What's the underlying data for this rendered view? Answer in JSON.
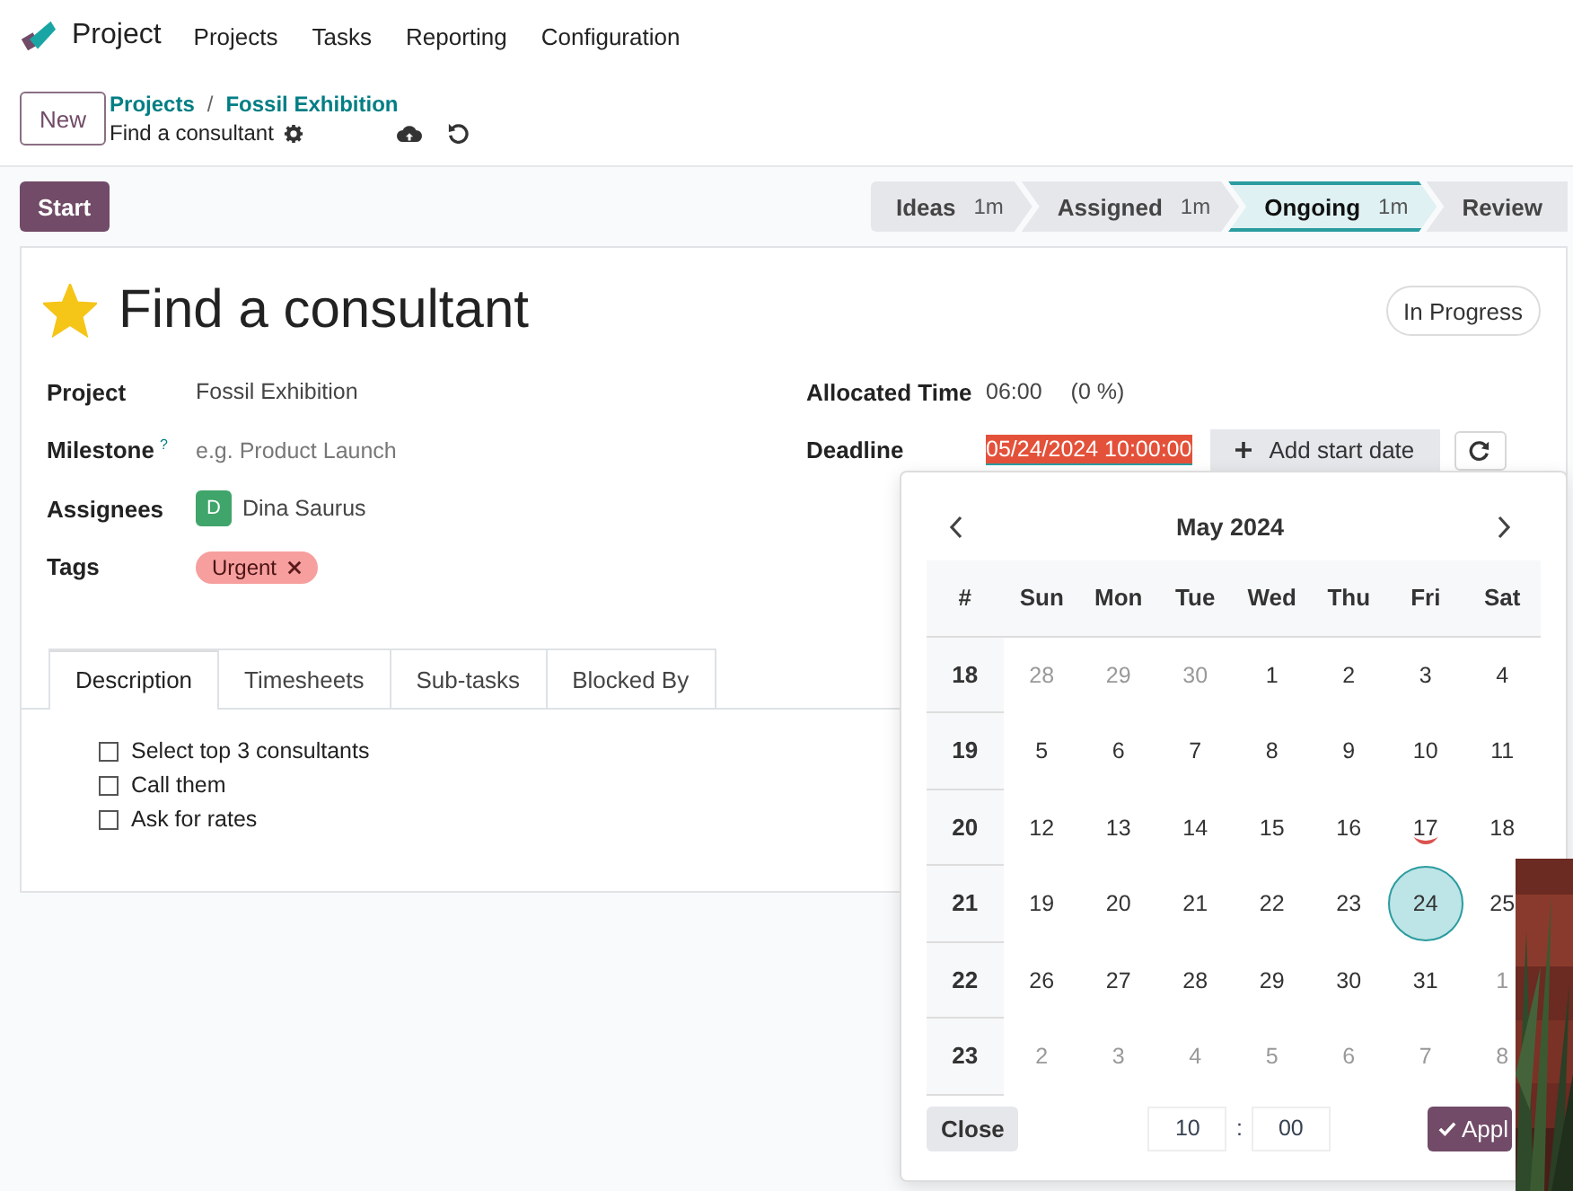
{
  "app": {
    "name": "Project",
    "menu": [
      "Projects",
      "Tasks",
      "Reporting",
      "Configuration"
    ]
  },
  "control_panel": {
    "new_button": "New",
    "breadcrumbs": [
      "Projects",
      "Fossil Exhibition"
    ],
    "breadcrumb_separator": "/",
    "record_name": "Find a consultant"
  },
  "start_button": "Start",
  "stages": [
    {
      "label": "Ideas",
      "duration": "1m",
      "selected": false
    },
    {
      "label": "Assigned",
      "duration": "1m",
      "selected": false
    },
    {
      "label": "Ongoing",
      "duration": "1m",
      "selected": true
    },
    {
      "label": "Review",
      "selected": false
    }
  ],
  "task": {
    "starred": true,
    "title": "Find a consultant",
    "status": "In Progress",
    "left_fields": [
      {
        "kind": "text",
        "label": "Project",
        "value": "Fossil Exhibition"
      },
      {
        "kind": "placeholder",
        "label": "Milestone",
        "help": "?",
        "placeholder": "e.g. Product Launch"
      },
      {
        "kind": "user",
        "label": "Assignees",
        "initial": "D",
        "value": "Dina Saurus",
        "color": "#3fa56a"
      },
      {
        "kind": "tags",
        "label": "Tags",
        "tags": [
          {
            "label": "Urgent",
            "color": "#f79e9e"
          }
        ]
      }
    ],
    "allocated_time": {
      "label": "Allocated Time",
      "value": "06:00",
      "percent": "(0 %)"
    },
    "deadline": {
      "label": "Deadline",
      "value": "05/24/2024 10:00:00",
      "add_start_date": "Add start date"
    }
  },
  "tabs": [
    {
      "label": "Description",
      "selected": true
    },
    {
      "label": "Timesheets",
      "selected": false
    },
    {
      "label": "Sub-tasks",
      "selected": false
    },
    {
      "label": "Blocked By",
      "selected": false
    }
  ],
  "checklist": [
    {
      "label": "Select top 3 consultants",
      "checked": false
    },
    {
      "label": "Call them",
      "checked": false
    },
    {
      "label": "Ask for rates",
      "checked": false
    }
  ],
  "datepicker": {
    "month": "May 2024",
    "week_header": "#",
    "weekdays": [
      "Sun",
      "Mon",
      "Tue",
      "Wed",
      "Thu",
      "Fri",
      "Sat"
    ],
    "weeks": [
      {
        "number": "18",
        "days": [
          {
            "day": "28",
            "muted": true
          },
          {
            "day": "29",
            "muted": true
          },
          {
            "day": "30",
            "muted": true
          },
          {
            "day": "1"
          },
          {
            "day": "2"
          },
          {
            "day": "3"
          },
          {
            "day": "4"
          }
        ]
      },
      {
        "number": "19",
        "days": [
          {
            "day": "5"
          },
          {
            "day": "6"
          },
          {
            "day": "7"
          },
          {
            "day": "8"
          },
          {
            "day": "9"
          },
          {
            "day": "10"
          },
          {
            "day": "11"
          }
        ]
      },
      {
        "number": "20",
        "days": [
          {
            "day": "12"
          },
          {
            "day": "13"
          },
          {
            "day": "14"
          },
          {
            "day": "15"
          },
          {
            "day": "16"
          },
          {
            "day": "17",
            "today": true
          },
          {
            "day": "18"
          }
        ]
      },
      {
        "number": "21",
        "days": [
          {
            "day": "19"
          },
          {
            "day": "20"
          },
          {
            "day": "21"
          },
          {
            "day": "22"
          },
          {
            "day": "23"
          },
          {
            "day": "24",
            "selected": true
          },
          {
            "day": "25"
          }
        ]
      },
      {
        "number": "22",
        "days": [
          {
            "day": "26"
          },
          {
            "day": "27"
          },
          {
            "day": "28"
          },
          {
            "day": "29"
          },
          {
            "day": "30"
          },
          {
            "day": "31"
          },
          {
            "day": "1",
            "muted": true
          }
        ]
      },
      {
        "number": "23",
        "days": [
          {
            "day": "2",
            "muted": true
          },
          {
            "day": "3",
            "muted": true
          },
          {
            "day": "4",
            "muted": true
          },
          {
            "day": "5",
            "muted": true
          },
          {
            "day": "6",
            "muted": true
          },
          {
            "day": "7",
            "muted": true
          },
          {
            "day": "8",
            "muted": true
          }
        ]
      }
    ],
    "close_button": "Close",
    "hour": "10",
    "separator": ":",
    "minute": "00",
    "apply_button": "Appl"
  }
}
